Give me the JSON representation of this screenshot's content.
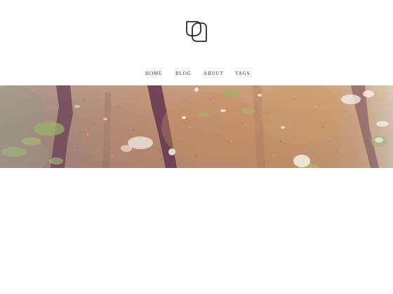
{
  "logo": {
    "icon": "overlapping-rounded-squares-logo"
  },
  "nav": {
    "items": [
      {
        "label": "HOME"
      },
      {
        "label": "BLOG"
      },
      {
        "label": "ABOUT"
      },
      {
        "label": "TAGS"
      }
    ]
  },
  "hero": {
    "image": "abstract-painted-texture-banner"
  },
  "colors": {
    "text": "#333333",
    "logo_stroke": "#2b2b2b",
    "background": "#ffffff"
  }
}
